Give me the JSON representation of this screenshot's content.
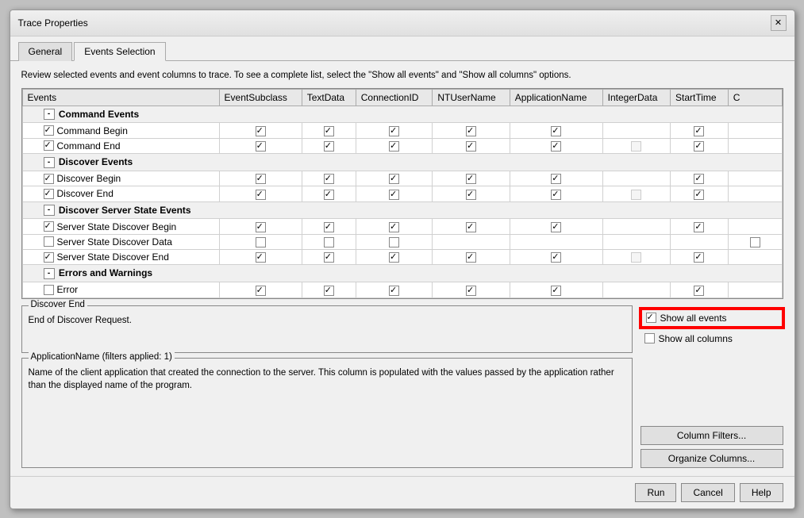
{
  "dialog": {
    "title": "Trace Properties",
    "close_label": "✕"
  },
  "tabs": [
    {
      "id": "general",
      "label": "General",
      "active": false
    },
    {
      "id": "events-selection",
      "label": "Events Selection",
      "active": true
    }
  ],
  "instruction": "Review selected events and event columns to trace. To see a complete list, select the \"Show all events\" and \"Show all columns\" options.",
  "table": {
    "columns": [
      "Events",
      "EventSubclass",
      "TextData",
      "ConnectionID",
      "NTUserName",
      "ApplicationName",
      "IntegerData",
      "StartTime",
      "C"
    ],
    "groups": [
      {
        "id": "command-events",
        "label": "Command Events",
        "expanded": true,
        "rows": [
          {
            "name": "Command Begin",
            "checked": true,
            "cols": [
              true,
              true,
              true,
              true,
              true,
              false,
              true
            ]
          },
          {
            "name": "Command End",
            "checked": true,
            "cols": [
              true,
              true,
              true,
              true,
              true,
              false,
              true
            ]
          }
        ]
      },
      {
        "id": "discover-events",
        "label": "Discover Events",
        "expanded": true,
        "rows": [
          {
            "name": "Discover Begin",
            "checked": true,
            "cols": [
              true,
              true,
              true,
              true,
              true,
              false,
              true
            ]
          },
          {
            "name": "Discover End",
            "checked": true,
            "cols": [
              true,
              true,
              true,
              true,
              true,
              false,
              true
            ]
          }
        ]
      },
      {
        "id": "discover-server-state",
        "label": "Discover Server State Events",
        "expanded": true,
        "rows": [
          {
            "name": "Server State Discover Begin",
            "checked": true,
            "cols": [
              true,
              true,
              true,
              true,
              true,
              false,
              true
            ]
          },
          {
            "name": "Server State Discover Data",
            "checked": false,
            "cols": [
              false,
              false,
              false,
              false,
              false,
              false,
              false
            ]
          },
          {
            "name": "Server State Discover End",
            "checked": true,
            "cols": [
              true,
              true,
              true,
              true,
              true,
              false,
              true
            ]
          }
        ]
      },
      {
        "id": "errors-warnings",
        "label": "Errors and Warnings",
        "expanded": true,
        "rows": [
          {
            "name": "Error",
            "checked": true,
            "cols": [
              true,
              true,
              true,
              true,
              true,
              false,
              true
            ]
          }
        ]
      }
    ]
  },
  "discover_end_box": {
    "title": "Discover End",
    "content": "End of Discover Request."
  },
  "show_options": {
    "show_all_events_label": "Show all events",
    "show_all_columns_label": "Show all columns",
    "show_all_events_checked": true,
    "show_all_columns_checked": false,
    "highlighted": true
  },
  "app_name_box": {
    "title": "ApplicationName (filters applied: 1)",
    "content": "Name of the client application that created the connection to the server. This column is populated with the values passed by the application rather than the displayed name of the program."
  },
  "buttons": {
    "column_filters": "Column Filters...",
    "organize_columns": "Organize Columns...",
    "run": "Run",
    "cancel": "Cancel",
    "help": "Help"
  }
}
